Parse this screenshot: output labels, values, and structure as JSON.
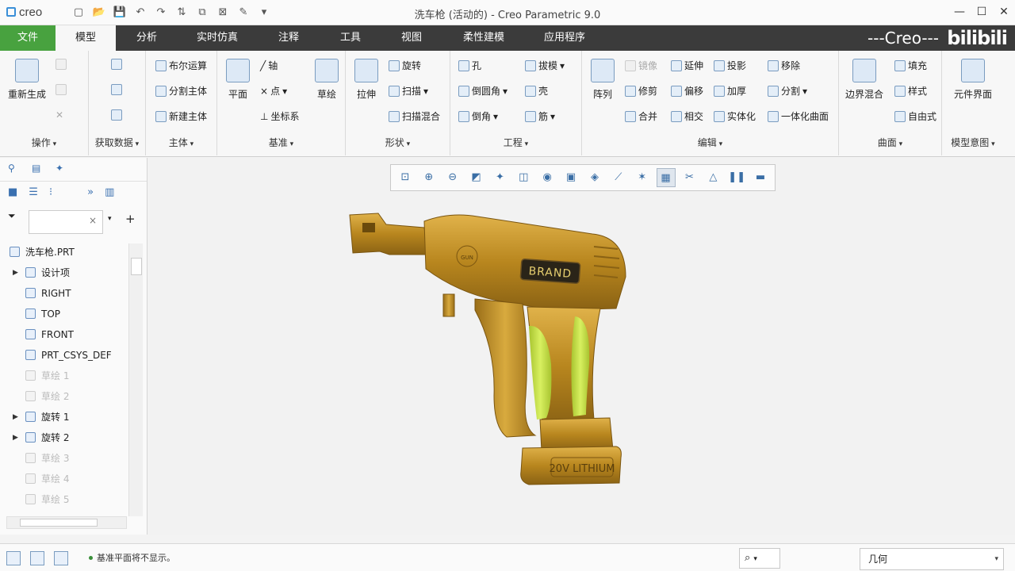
{
  "app": {
    "logo": "creo",
    "window_title": "洗车枪 (活动的) - Creo Parametric 9.0",
    "brand_overlay": "---Creo---",
    "watermark": "bilibili"
  },
  "tabs": [
    {
      "label": "文件"
    },
    {
      "label": "模型"
    },
    {
      "label": "分析"
    },
    {
      "label": "实时仿真"
    },
    {
      "label": "注释"
    },
    {
      "label": "工具"
    },
    {
      "label": "视图"
    },
    {
      "label": "柔性建模"
    },
    {
      "label": "应用程序"
    }
  ],
  "ribbon": {
    "operations": {
      "label": "操作",
      "regenerate": "重新生成"
    },
    "get_data": {
      "label": "获取数据"
    },
    "body": {
      "label": "主体",
      "boolean": "布尔运算",
      "split_body": "分割主体",
      "new_body": "新建主体"
    },
    "datum": {
      "label": "基准",
      "plane": "平面",
      "axis": "轴",
      "point": "点",
      "csys": "坐标系",
      "sketch": "草绘"
    },
    "shapes": {
      "label": "形状",
      "extrude": "拉伸",
      "revolve": "旋转",
      "sweep": "扫描",
      "swept_blend": "扫描混合"
    },
    "engineering": {
      "label": "工程",
      "hole": "孔",
      "round": "倒圆角",
      "chamfer": "倒角",
      "draft": "拔模",
      "shell": "壳",
      "rib": "筋"
    },
    "editing": {
      "label": "编辑",
      "pattern": "阵列",
      "mirror": "镜像",
      "extend": "延伸",
      "project": "投影",
      "move": "移除",
      "trim": "修剪",
      "offset": "偏移",
      "thicken": "加厚",
      "split": "分割",
      "merge": "合并",
      "intersect": "相交",
      "solidify": "实体化",
      "unify": "一体化曲面"
    },
    "surfaces": {
      "label": "曲面",
      "boundary_blend": "边界混合",
      "fill": "填充",
      "style": "样式",
      "freestyle": "自由式"
    },
    "model_intent": {
      "label": "模型意图",
      "component_interface": "元件界面"
    }
  },
  "model_tree": {
    "root": "洗车枪.PRT",
    "items": [
      {
        "label": "设计项",
        "expandable": true,
        "dim": false
      },
      {
        "label": "RIGHT",
        "expandable": false,
        "dim": false
      },
      {
        "label": "TOP",
        "expandable": false,
        "dim": false
      },
      {
        "label": "FRONT",
        "expandable": false,
        "dim": false
      },
      {
        "label": "PRT_CSYS_DEF",
        "expandable": false,
        "dim": false
      },
      {
        "label": "草绘 1",
        "expandable": false,
        "dim": true
      },
      {
        "label": "草绘 2",
        "expandable": false,
        "dim": true
      },
      {
        "label": "旋转 1",
        "expandable": true,
        "dim": false
      },
      {
        "label": "旋转 2",
        "expandable": true,
        "dim": false
      },
      {
        "label": "草绘 3",
        "expandable": false,
        "dim": true
      },
      {
        "label": "草绘 4",
        "expandable": false,
        "dim": true
      },
      {
        "label": "草绘 5",
        "expandable": false,
        "dim": true
      }
    ]
  },
  "model": {
    "logo_text": "GUN",
    "brand_label": "BRAND",
    "battery_label": "20V  LITHIUM",
    "colors": {
      "body": "#b8861e",
      "grip": "#c8e050",
      "label_bg": "#2a2418"
    }
  },
  "statusbar": {
    "message": "基准平面将不显示。",
    "filter_value": "几何"
  }
}
